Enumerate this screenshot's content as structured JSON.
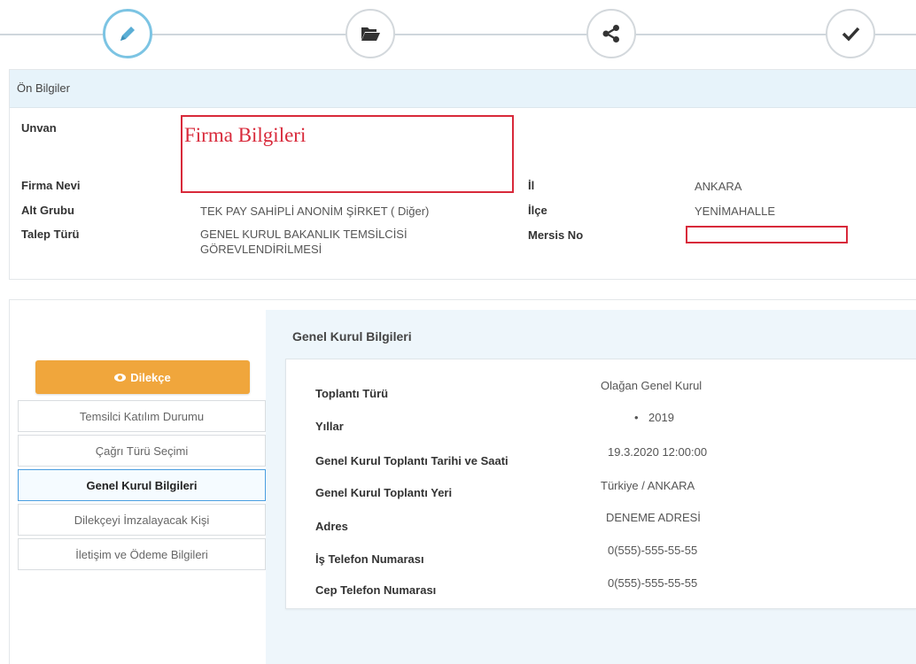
{
  "wizard": {
    "steps": [
      {
        "icon": "pencil-icon",
        "active": true
      },
      {
        "icon": "folder-open-icon",
        "active": false
      },
      {
        "icon": "share-icon",
        "active": false
      },
      {
        "icon": "check-icon",
        "active": false
      }
    ]
  },
  "on_bilgiler": {
    "heading": "Ön Bilgiler",
    "unvan_label": "Unvan",
    "firma_annotation": "Firma Bilgileri",
    "firma_nevi_label": "Firma Nevi",
    "alt_grubu_label": "Alt Grubu",
    "alt_grubu_value": "TEK PAY SAHİPLİ ANONİM ŞİRKET ( Diğer)",
    "talep_turu_label": "Talep Türü",
    "talep_turu_value_line1": "GENEL KURUL BAKANLIK TEMSİLCİSİ",
    "talep_turu_value_line2": "GÖREVLENDİRİLMESİ",
    "il_label": "İl",
    "il_value": "ANKARA",
    "ilce_label": "İlçe",
    "ilce_value": "YENİMAHALLE",
    "mersis_label": "Mersis No"
  },
  "sidebar": {
    "dilekce_label": "Dilekçe",
    "items": [
      {
        "label": "Temsilci Katılım Durumu",
        "active": false
      },
      {
        "label": "Çağrı Türü Seçimi",
        "active": false
      },
      {
        "label": "Genel Kurul Bilgileri",
        "active": true
      },
      {
        "label": "Dilekçeyi İmzalayacak Kişi",
        "active": false
      },
      {
        "label": "İletişim ve Ödeme Bilgileri",
        "active": false
      }
    ]
  },
  "genel_kurul": {
    "heading": "Genel Kurul Bilgileri",
    "toplanti_turu_label": "Toplantı Türü",
    "toplanti_turu_value": "Olağan Genel Kurul",
    "yillar_label": "Yıllar",
    "yillar_value": "2019",
    "tarih_label": "Genel Kurul Toplantı Tarihi ve Saati",
    "tarih_value": "19.3.2020 12:00:00",
    "yer_label": "Genel Kurul Toplantı Yeri",
    "yer_value": "Türkiye / ANKARA",
    "adres_label": "Adres",
    "adres_value": "DENEME ADRESİ",
    "is_tel_label": "İş Telefon Numarası",
    "is_tel_value": "0(555)-555-55-55",
    "cep_tel_label": "Cep Telefon Numarası",
    "cep_tel_value": "0(555)-555-55-55"
  },
  "colors": {
    "accent_blue": "#7cc4e3",
    "orange": "#f0a63c",
    "annotation_red": "#d8293a",
    "panel_blue": "#e7f3fa"
  }
}
